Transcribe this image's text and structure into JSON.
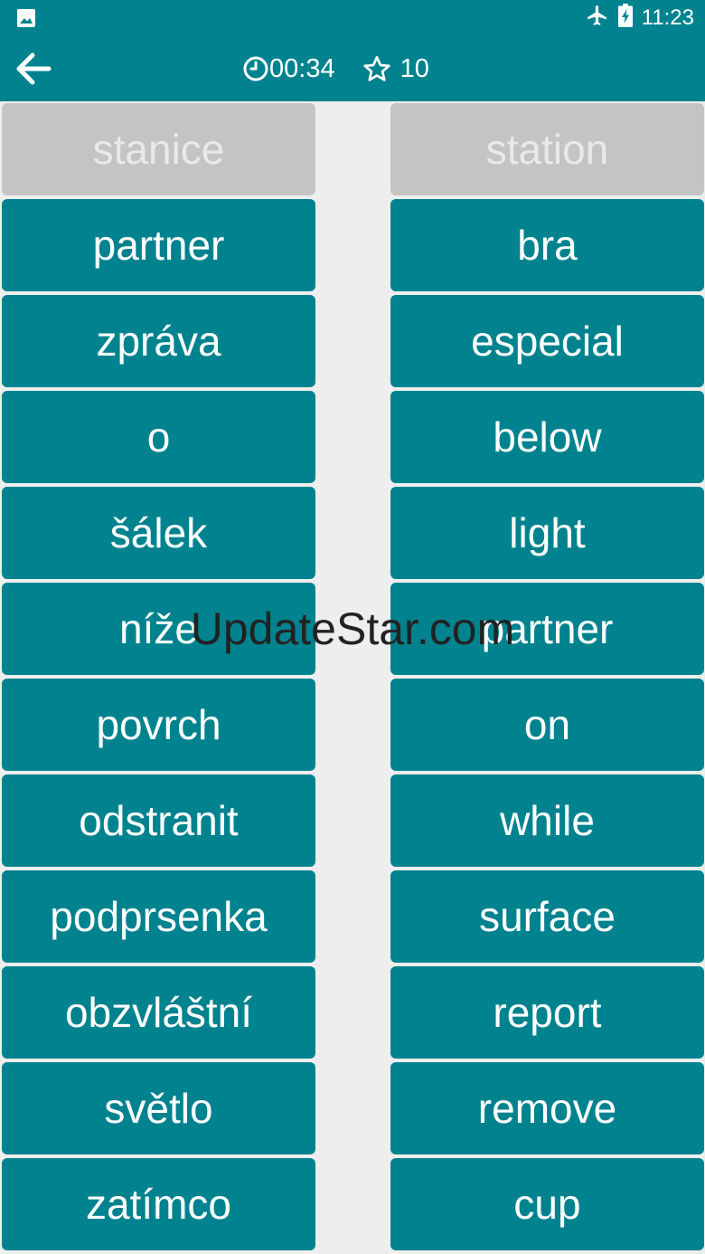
{
  "status_bar": {
    "notification_icon": "image-icon",
    "airplane_icon": "airplane-icon",
    "battery_icon": "battery-charging-icon",
    "time": "11:23"
  },
  "toolbar": {
    "back_icon": "arrow-back-icon",
    "timer_icon": "clock-icon",
    "timer": "00:34",
    "score_icon": "star-outline-icon",
    "score": "10"
  },
  "left_column": [
    {
      "text": "stanice",
      "matched": true
    },
    {
      "text": "partner",
      "matched": false
    },
    {
      "text": "zpráva",
      "matched": false
    },
    {
      "text": "o",
      "matched": false
    },
    {
      "text": "šálek",
      "matched": false
    },
    {
      "text": "níže",
      "matched": false
    },
    {
      "text": "povrch",
      "matched": false
    },
    {
      "text": "odstranit",
      "matched": false
    },
    {
      "text": "podprsenka",
      "matched": false
    },
    {
      "text": "obzvláštní",
      "matched": false
    },
    {
      "text": "světlo",
      "matched": false
    },
    {
      "text": "zatímco",
      "matched": false
    }
  ],
  "right_column": [
    {
      "text": "station",
      "matched": true
    },
    {
      "text": "bra",
      "matched": false
    },
    {
      "text": "especial",
      "matched": false
    },
    {
      "text": "below",
      "matched": false
    },
    {
      "text": "light",
      "matched": false
    },
    {
      "text": "partner",
      "matched": false
    },
    {
      "text": "on",
      "matched": false
    },
    {
      "text": "while",
      "matched": false
    },
    {
      "text": "surface",
      "matched": false
    },
    {
      "text": "report",
      "matched": false
    },
    {
      "text": "remove",
      "matched": false
    },
    {
      "text": "cup",
      "matched": false
    }
  ],
  "watermark": "UpdateStar.com",
  "colors": {
    "primary": "#00838f",
    "matched_tile": "#c4c4c4",
    "matched_text": "#e9e9e9",
    "background": "#eeeeee"
  }
}
